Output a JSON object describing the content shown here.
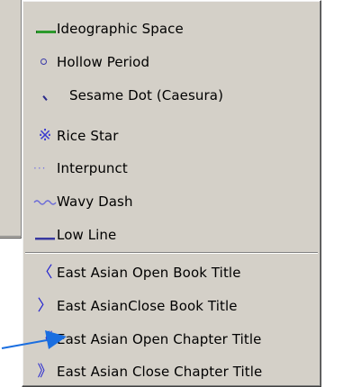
{
  "menu": {
    "items": [
      {
        "id": "ideographic-space",
        "label": "Ideographic Space",
        "icon": "ideographic-space-icon"
      },
      {
        "id": "hollow-period",
        "label": "Hollow Period",
        "icon": "hollow-period-icon"
      },
      {
        "id": "sesame-dot",
        "label": "Sesame Dot (Caesura)",
        "icon": "sesame-dot-icon"
      },
      {
        "id": "rice-star",
        "label": "Rice Star",
        "icon": "rice-star-icon",
        "glyph": "※"
      },
      {
        "id": "interpunct",
        "label": "Interpunct",
        "icon": "interpunct-icon",
        "glyph": "···"
      },
      {
        "id": "wavy-dash",
        "label": "Wavy Dash",
        "icon": "wavy-dash-icon"
      },
      {
        "id": "low-line",
        "label": "Low Line",
        "icon": "low-line-icon"
      },
      {
        "id": "open-book-title",
        "label": "East Asian Open Book Title",
        "icon": "open-book-title-icon",
        "glyph": "〈"
      },
      {
        "id": "close-book-title",
        "label": "East AsianClose Book Title",
        "icon": "close-book-title-icon",
        "glyph": "〉"
      },
      {
        "id": "open-chapter-title",
        "label": "East Asian Open Chapter Title",
        "icon": "open-chapter-title-icon",
        "glyph": "《"
      },
      {
        "id": "close-chapter-title",
        "label": "East Asian Close Chapter Title",
        "icon": "close-chapter-title-icon",
        "glyph": "》"
      }
    ]
  },
  "colors": {
    "menu_bg": "#d4d0c8",
    "icon_blue": "#2020d0",
    "icon_green": "#2c9a2c",
    "arrow": "#1a6ee0"
  }
}
